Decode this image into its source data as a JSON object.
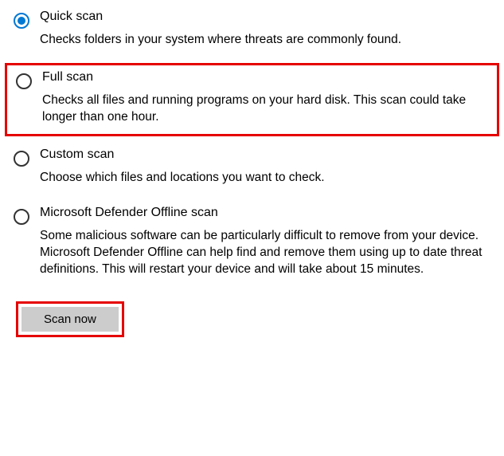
{
  "options": [
    {
      "title": "Quick scan",
      "desc": "Checks folders in your system where threats are commonly found.",
      "selected": true,
      "highlighted": false
    },
    {
      "title": "Full scan",
      "desc": "Checks all files and running programs on your hard disk. This scan could take longer than one hour.",
      "selected": false,
      "highlighted": true
    },
    {
      "title": "Custom scan",
      "desc": "Choose which files and locations you want to check.",
      "selected": false,
      "highlighted": false
    },
    {
      "title": "Microsoft Defender Offline scan",
      "desc": "Some malicious software can be particularly difficult to remove from your device. Microsoft Defender Offline can help find and remove them using up to date threat definitions. This will restart your device and will take about 15 minutes.",
      "selected": false,
      "highlighted": false
    }
  ],
  "button_label": "Scan now",
  "highlight_color": "#e60000",
  "accent_color": "#0078d4"
}
